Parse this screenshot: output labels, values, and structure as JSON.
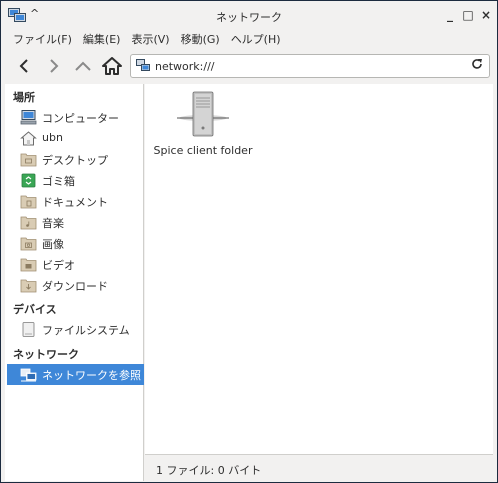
{
  "window": {
    "title": "ネットワーク",
    "menu_arrow": "^",
    "minimize": "_",
    "maximize": "□",
    "close": "×"
  },
  "menubar": {
    "items": [
      "ファイル(F)",
      "編集(E)",
      "表示(V)",
      "移動(G)",
      "ヘルプ(H)"
    ]
  },
  "toolbar": {
    "back_icon": "chevron-left-icon",
    "forward_icon": "chevron-right-icon",
    "up_icon": "chevron-up-icon",
    "home_icon": "home-icon",
    "location": "network:///",
    "reload_icon": "reload-icon"
  },
  "sidebar": {
    "places_heading": "場所",
    "places": [
      {
        "label": "コンピューター",
        "icon": "computer-icon"
      },
      {
        "label": "ubn",
        "icon": "home-folder-icon"
      },
      {
        "label": "デスクトップ",
        "icon": "desktop-folder-icon"
      },
      {
        "label": "ゴミ箱",
        "icon": "trash-icon"
      },
      {
        "label": "ドキュメント",
        "icon": "documents-folder-icon"
      },
      {
        "label": "音楽",
        "icon": "music-folder-icon"
      },
      {
        "label": "画像",
        "icon": "pictures-folder-icon"
      },
      {
        "label": "ビデオ",
        "icon": "videos-folder-icon"
      },
      {
        "label": "ダウンロード",
        "icon": "downloads-folder-icon"
      }
    ],
    "devices_heading": "デバイス",
    "devices": [
      {
        "label": "ファイルシステム",
        "icon": "drive-icon"
      }
    ],
    "network_heading": "ネットワーク",
    "network": [
      {
        "label": "ネットワークを参照",
        "icon": "network-icon",
        "selected": true
      }
    ]
  },
  "main": {
    "items": [
      {
        "name": "Spice client folder",
        "icon": "server-icon"
      }
    ]
  },
  "status": {
    "text": "1 ファイル: 0 バイト"
  },
  "colors": {
    "accent": "#3e87d8",
    "trash_green": "#3aa655",
    "folder": "#c8b89a"
  }
}
